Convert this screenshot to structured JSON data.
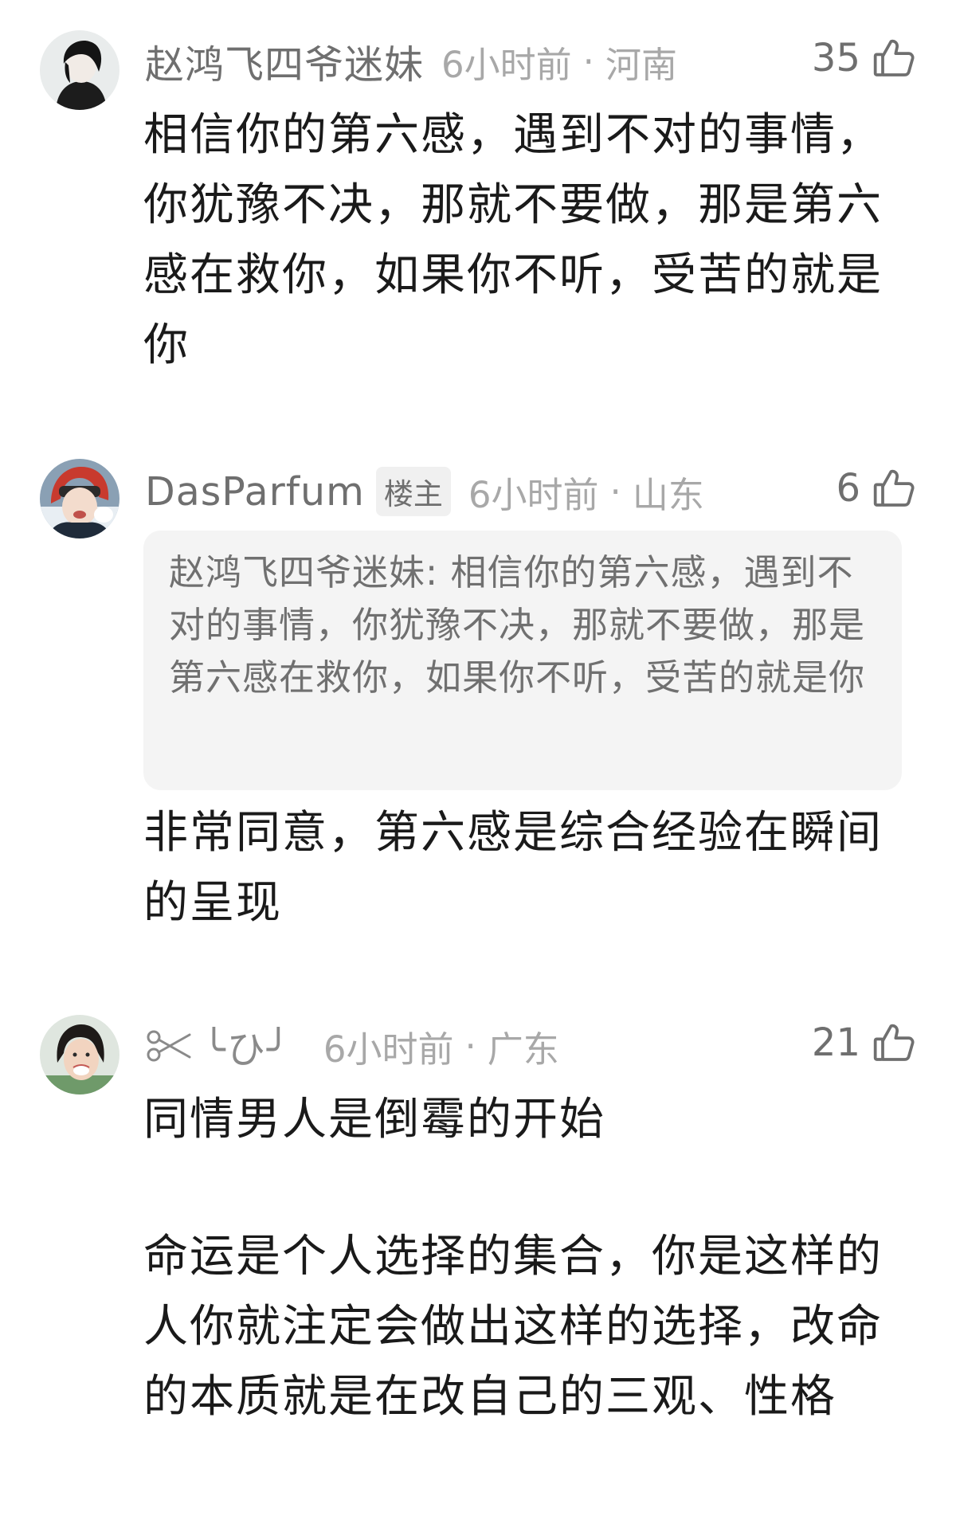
{
  "comments": [
    {
      "username": "赵鸿飞四爷迷妹",
      "time": "6小时前",
      "location": "河南",
      "likes": "35",
      "text": "相信你的第六感，遇到不对的事情，你犹豫不决，那就不要做，那是第六感在救你，如果你不听，受苦的就是你"
    },
    {
      "username": "DasParfum",
      "badge": "楼主",
      "time": "6小时前",
      "location": "山东",
      "likes": "6",
      "quote": "赵鸿飞四爷迷妹: 相信你的第六感，遇到不对的事情，你犹豫不决，那就不要做，那是第六感在救你，如果你不听，受苦的就是你",
      "text": "非常同意，第六感是综合经验在瞬间的呈现"
    },
    {
      "username": "╰ひ╯",
      "time": "6小时前",
      "location": "广东",
      "likes": "21",
      "text_lines": [
        "同情男人是倒霉的开始",
        "命运是个人选择的集合，你是这样的人你就注定会做出这样的选择，改命的本质就是在改自己的三观、性格"
      ]
    }
  ],
  "separator": "·",
  "icons": {
    "like": "thumbs-up-icon",
    "scissors": "scissors-icon"
  },
  "colors": {
    "username": "#6f6f6f",
    "meta": "#a8a8a8",
    "body": "#1a1a1a",
    "quote_bg": "#f4f4f4",
    "quote_text": "#707070"
  }
}
